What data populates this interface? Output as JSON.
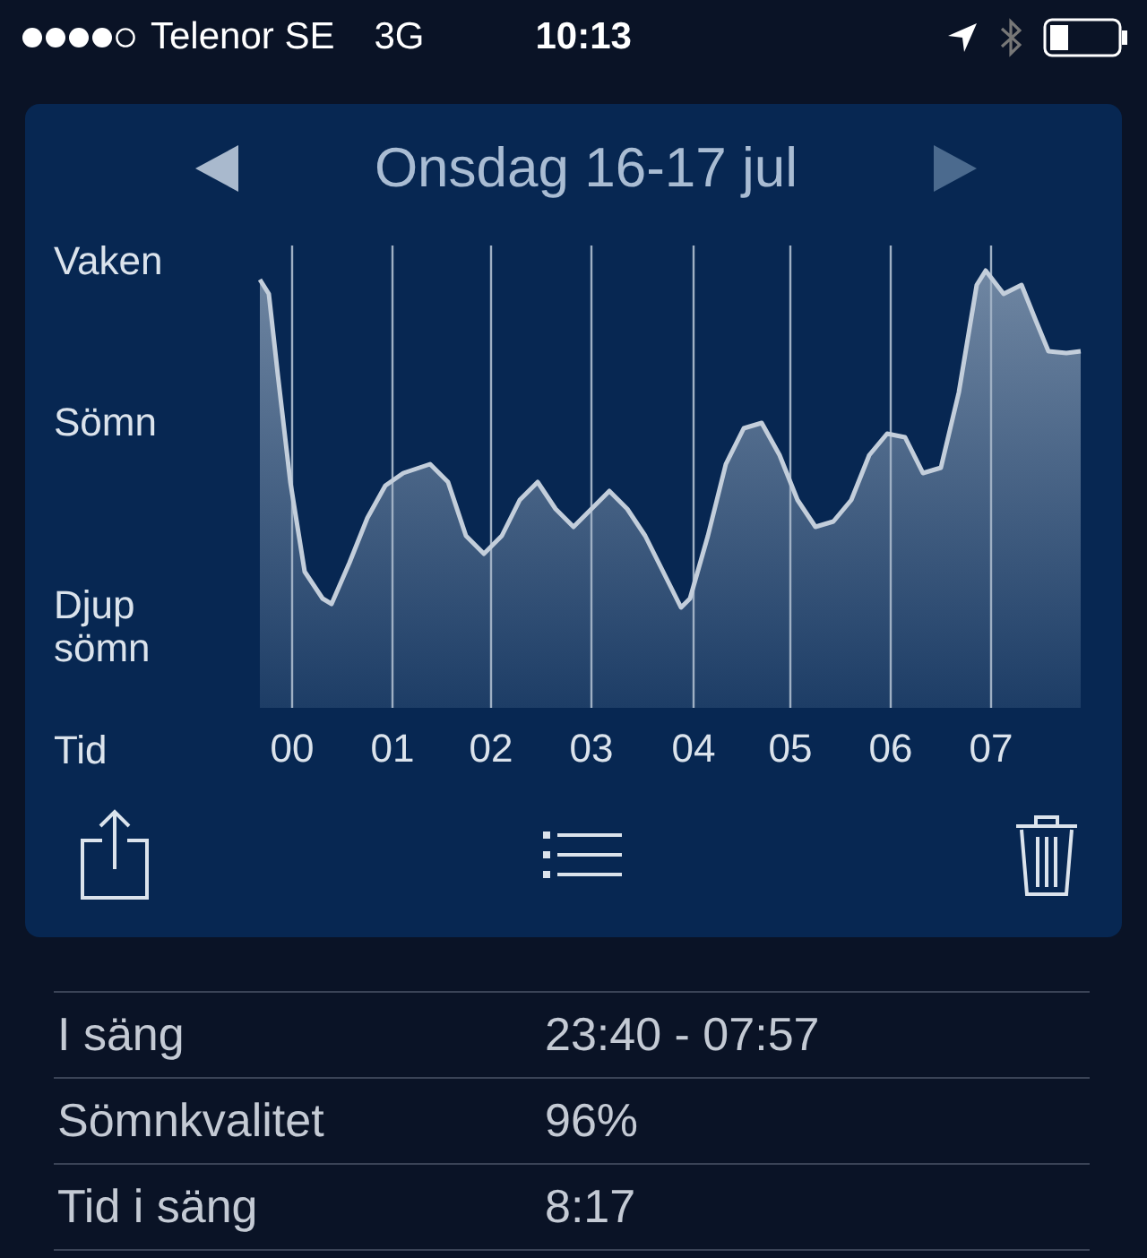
{
  "status_bar": {
    "carrier": "Telenor SE",
    "network": "3G",
    "time": "10:13"
  },
  "header": {
    "title": "Onsdag 16-17 jul"
  },
  "chart": {
    "y_labels": [
      "Vaken",
      "Sömn",
      "Djup sömn"
    ],
    "x_axis_label": "Tid",
    "x_labels": [
      "00",
      "01",
      "02",
      "03",
      "04",
      "05",
      "06",
      "07"
    ]
  },
  "stats": [
    {
      "label": "I säng",
      "value": "23:40 - 07:57"
    },
    {
      "label": "Sömnkvalitet",
      "value": "96%"
    },
    {
      "label": "Tid i säng",
      "value": "8:17"
    }
  ]
}
